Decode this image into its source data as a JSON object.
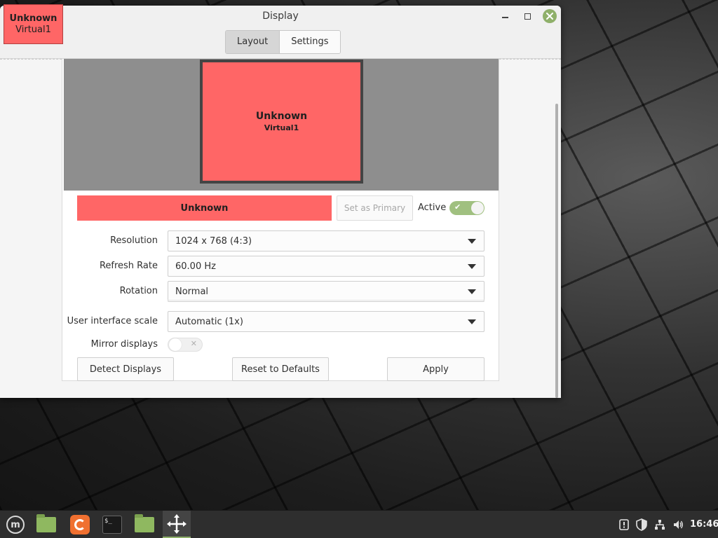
{
  "badge": {
    "name": "Unknown",
    "connector": "Virtual1"
  },
  "window": {
    "title": "Display"
  },
  "tabs": [
    {
      "label": "Layout"
    },
    {
      "label": "Settings"
    }
  ],
  "monitor": {
    "name": "Unknown",
    "connector": "Virtual1",
    "color": "#ff6666"
  },
  "output": {
    "name": "Unknown",
    "set_primary_label": "Set as Primary",
    "active_label": "Active",
    "active": true
  },
  "settings": {
    "resolution": {
      "label": "Resolution",
      "value": "1024 x 768 (4:3)"
    },
    "refresh_rate": {
      "label": "Refresh Rate",
      "value": "60.00 Hz"
    },
    "rotation": {
      "label": "Rotation",
      "value": "Normal"
    },
    "ui_scale": {
      "label": "User interface scale",
      "value": "Automatic (1x)"
    },
    "mirror": {
      "label": "Mirror displays",
      "enabled": false
    }
  },
  "buttons": {
    "detect": "Detect Displays",
    "reset": "Reset to Defaults",
    "apply": "Apply"
  },
  "taskbar": {
    "items": [
      "mint-menu-icon",
      "files-icon",
      "firefox-icon",
      "terminal-icon",
      "folder-icon",
      "display-icon"
    ],
    "clock": "16:46",
    "accent": "#8fb06a"
  }
}
